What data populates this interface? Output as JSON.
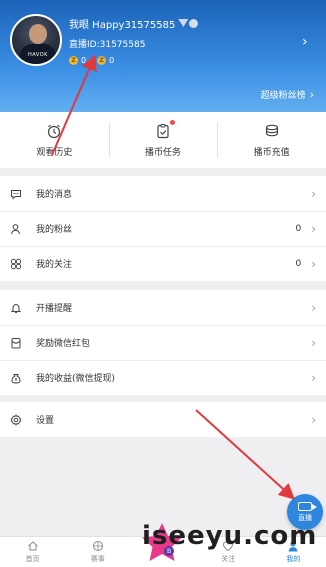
{
  "profile": {
    "username": "我眼 Happy31575585",
    "live_id": "直播ID:31575585",
    "coin_a": "0",
    "coin_b": "0",
    "avatar_text": "HAVOK"
  },
  "header": {
    "fans_rank": "超级粉丝榜"
  },
  "quick_actions": [
    {
      "label": "观看历史",
      "icon": "alarm-clock-icon"
    },
    {
      "label": "播币任务",
      "icon": "clipboard-check-icon",
      "dot": true
    },
    {
      "label": "播币充值",
      "icon": "coin-stack-icon"
    }
  ],
  "groups": {
    "g1": [
      {
        "label": "我的消息",
        "icon": "chat-bubble-icon"
      },
      {
        "label": "我的粉丝",
        "icon": "user-icon",
        "count": "0"
      },
      {
        "label": "我的关注",
        "icon": "clover-icon",
        "count": "0"
      }
    ],
    "g2": [
      {
        "label": "开播提醒",
        "icon": "bell-icon"
      },
      {
        "label": "奖励微信红包",
        "icon": "red-envelope-icon"
      },
      {
        "label": "我的收益(微信提现)",
        "icon": "money-bag-icon"
      }
    ],
    "g3": [
      {
        "label": "设置",
        "icon": "gear-icon"
      }
    ]
  },
  "fab": {
    "label": "直播"
  },
  "nav": [
    {
      "label": "首页",
      "icon": "home-icon"
    },
    {
      "label": "赛事",
      "icon": "trophy-icon"
    },
    {
      "label": "",
      "icon": "center-logo-icon"
    },
    {
      "label": "关注",
      "icon": "heart-icon"
    },
    {
      "label": "我的",
      "icon": "profile-icon",
      "active": true
    }
  ],
  "watermark": "iseeyu.com",
  "colors": {
    "accent": "#2e86de",
    "header_top": "#1b63b8",
    "arrow": "#e0393e"
  }
}
